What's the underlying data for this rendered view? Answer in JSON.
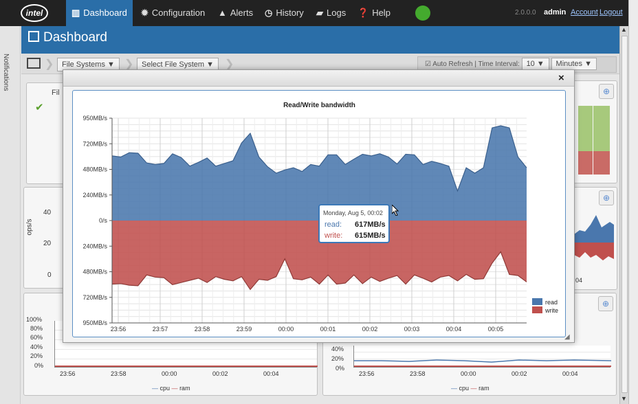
{
  "navbar": {
    "logo": "intel",
    "items": [
      {
        "label": "Dashboard",
        "icon": "bar-chart-icon",
        "glyph": "▥"
      },
      {
        "label": "Configuration",
        "icon": "gear-icon",
        "glyph": "✹"
      },
      {
        "label": "Alerts",
        "icon": "warning-icon",
        "glyph": "▲"
      },
      {
        "label": "History",
        "icon": "clock-icon",
        "glyph": "◷"
      },
      {
        "label": "Logs",
        "icon": "book-icon",
        "glyph": "▰"
      },
      {
        "label": "Help",
        "icon": "question-icon",
        "glyph": "❓"
      }
    ],
    "version": "2.0.0.0",
    "user": "admin",
    "account": "Account",
    "logout": "Logout",
    "status_color": "#44aa2e"
  },
  "sidebar": {
    "notifications_label": "Notifications"
  },
  "page": {
    "title": "Dashboard"
  },
  "filter": {
    "file_systems": "File Systems ▼",
    "select_file_system": "Select File System ▼",
    "auto_refresh": "Auto Refresh",
    "separator": "|",
    "time_interval": "Time Interval:",
    "interval_value": "10 ▼",
    "interval_unit": "Minutes ▼"
  },
  "background": {
    "card1_label": "Fil",
    "ops_label": "ops/s",
    "ops_ticks": [
      "40",
      "20",
      "0"
    ],
    "bottom_left": {
      "yticks": [
        "100%",
        "80%",
        "60%",
        "40%",
        "20%",
        "0%"
      ],
      "xticks": [
        "23:56",
        "23:58",
        "00:00",
        "00:02",
        "00:04"
      ],
      "legend": [
        "cpu",
        "ram"
      ]
    },
    "bottom_right": {
      "yticks": [
        "40%",
        "20%",
        "0%"
      ],
      "xticks": [
        "23:56",
        "23:58",
        "00:00",
        "00:02",
        "00:04"
      ],
      "legend": [
        "cpu",
        "ram"
      ]
    },
    "right_mid_xtick": "04"
  },
  "modal": {
    "close": "×",
    "tooltip": {
      "date": "Monday, Aug 5, 00:02",
      "read_label": "read:",
      "read_value": "617MB/s",
      "write_label": "write:",
      "write_value": "615MB/s"
    }
  },
  "chart_data": {
    "type": "area",
    "title": "Read/Write bandwidth",
    "ylabel": "",
    "xlabel": "",
    "y_ticks": [
      "950MB/s",
      "720MB/s",
      "480MB/s",
      "240MB/s",
      "0/s",
      "240MB/s",
      "480MB/s",
      "720MB/s",
      "950MB/s"
    ],
    "ylim": [
      -950,
      950
    ],
    "x_ticks": [
      "23:56",
      "23:57",
      "23:58",
      "23:59",
      "00:00",
      "00:01",
      "00:02",
      "00:03",
      "00:04",
      "00:05"
    ],
    "series": [
      {
        "name": "read",
        "color": "#4a77ad",
        "values": [
          600,
          590,
          630,
          625,
          535,
          520,
          530,
          620,
          585,
          505,
          540,
          580,
          505,
          530,
          555,
          720,
          810,
          590,
          500,
          440,
          470,
          490,
          455,
          520,
          505,
          610,
          610,
          520,
          570,
          615,
          600,
          620,
          590,
          525,
          615,
          610,
          520,
          550,
          530,
          505,
          275,
          490,
          440,
          490,
          860,
          880,
          860,
          590,
          490
        ]
      },
      {
        "name": "write",
        "color": "#c0504d",
        "values": [
          -590,
          -585,
          -600,
          -605,
          -505,
          -525,
          -530,
          -595,
          -575,
          -555,
          -535,
          -575,
          -520,
          -545,
          -560,
          -520,
          -640,
          -545,
          -555,
          -520,
          -355,
          -540,
          -550,
          -525,
          -590,
          -505,
          -590,
          -580,
          -505,
          -585,
          -525,
          -565,
          -535,
          -510,
          -590,
          -505,
          -535,
          -570,
          -525,
          -510,
          -560,
          -500,
          -545,
          -540,
          -395,
          -290,
          -500,
          -510,
          -570
        ]
      }
    ],
    "legend_position": "bottom-right",
    "grid": true
  }
}
